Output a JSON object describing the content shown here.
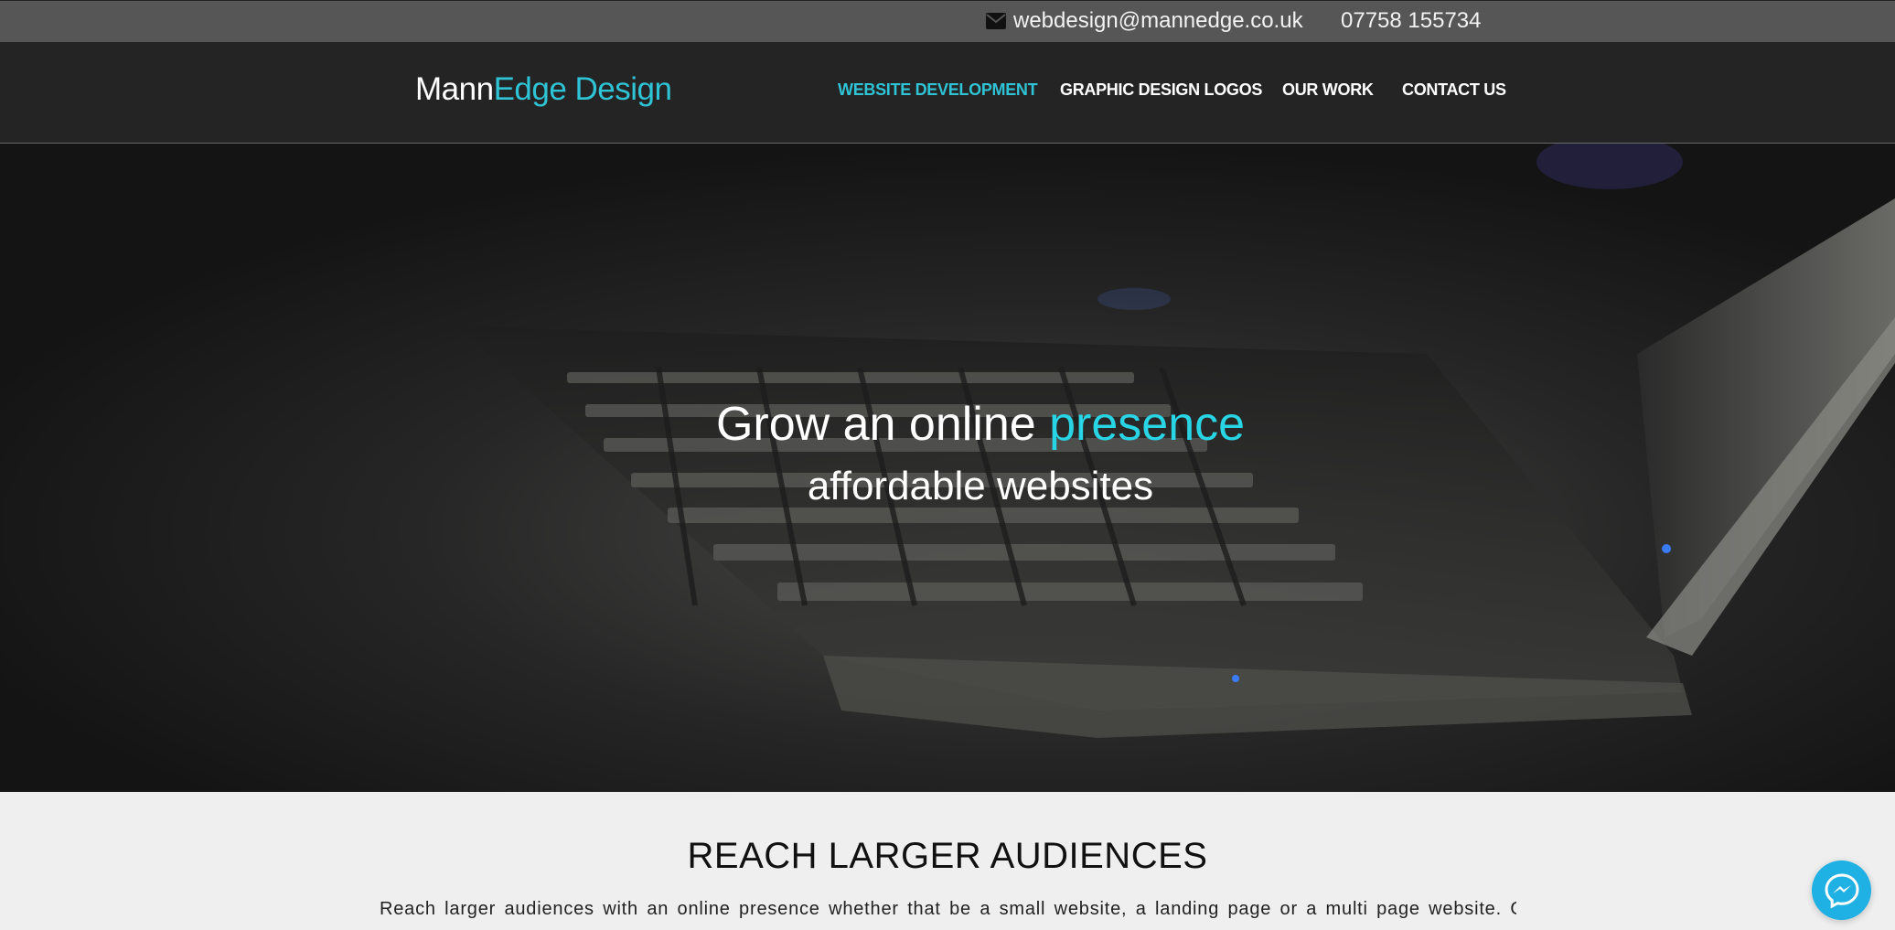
{
  "topbar": {
    "email": "webdesign@mannedge.co.uk",
    "phone": "07758 155734",
    "email_icon": "envelope-icon"
  },
  "header": {
    "logo": {
      "part1": "Mann",
      "part2": "Edge Design"
    },
    "nav": [
      {
        "label": "WEBSITE DEVELOPMENT",
        "active": true
      },
      {
        "label": "GRAPHIC DESIGN LOGOS",
        "active": false
      },
      {
        "label": "OUR WORK",
        "active": false
      },
      {
        "label": "CONTACT US",
        "active": false
      }
    ]
  },
  "hero": {
    "title_part1": "Grow an online ",
    "title_accent": "presence",
    "subtitle": "affordable websites"
  },
  "section": {
    "heading": "REACH LARGER AUDIENCES",
    "text": "Reach larger audiences with an online presence whether that be a small website, a landing page or a multi page website. Our"
  },
  "floating": {
    "icon": "messenger-icon"
  },
  "colors": {
    "accent": "#2fc3d6",
    "topbar": "#565656",
    "header": "#242424",
    "messenger": "#1fb0e4"
  }
}
